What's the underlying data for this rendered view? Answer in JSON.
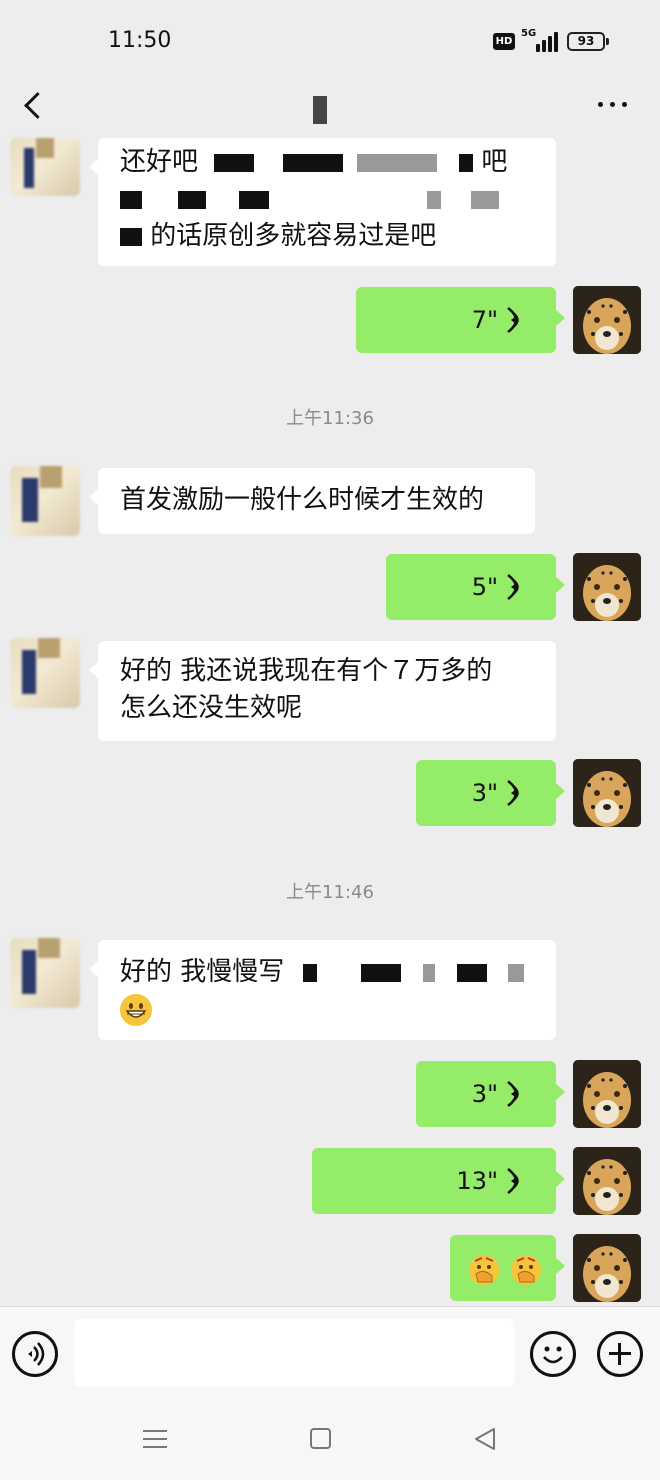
{
  "status_bar": {
    "time": "11:50",
    "hd": "HD",
    "network": "5G",
    "battery": "93"
  },
  "header": {
    "back_icon": "chevron-left-icon",
    "more_icon": "more-dots-icon"
  },
  "messages": [
    {
      "type": "incoming-text",
      "lines": [
        "还好吧",
        "吧",
        "的话原创多就容易过是吧"
      ]
    },
    {
      "type": "outgoing-voice",
      "duration": "7\""
    },
    {
      "type": "timestamp",
      "text": "上午11:36"
    },
    {
      "type": "incoming-text",
      "lines": [
        "首发激励一般什么时候才生效的"
      ]
    },
    {
      "type": "outgoing-voice",
      "duration": "5\""
    },
    {
      "type": "incoming-text",
      "lines": [
        "好的 我还说我现在有个７万多的",
        "怎么还没生效呢"
      ]
    },
    {
      "type": "outgoing-voice",
      "duration": "3\""
    },
    {
      "type": "timestamp",
      "text": "上午11:46"
    },
    {
      "type": "incoming-text",
      "lines": [
        "好的  我慢慢写"
      ],
      "emoji": "grinning-face-emoji"
    },
    {
      "type": "outgoing-voice",
      "duration": "3\""
    },
    {
      "type": "outgoing-voice",
      "duration": "13\""
    },
    {
      "type": "outgoing-emoji",
      "emoji": [
        "face-with-hand-over-mouth-emoji",
        "face-with-hand-over-mouth-emoji"
      ]
    }
  ],
  "input_bar": {
    "voice_icon": "voice-toggle-icon",
    "input_value": "",
    "emoji_icon": "emoji-icon",
    "plus_icon": "plus-icon"
  },
  "colors": {
    "background": "#ededed",
    "outgoing_bubble": "#95ec69",
    "incoming_bubble": "#ffffff",
    "timestamp": "#8a8a8a"
  }
}
